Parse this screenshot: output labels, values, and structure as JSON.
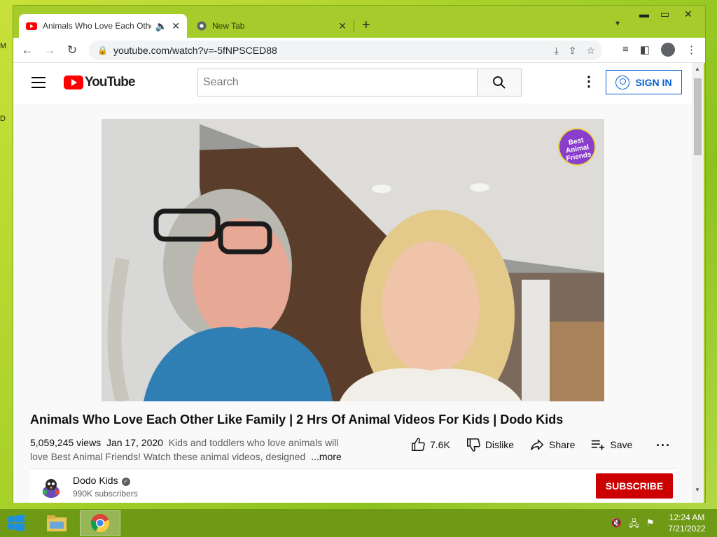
{
  "tabs": [
    {
      "label": "Animals Who Love Each Other Like Family",
      "active": true,
      "audio": true
    },
    {
      "label": "New Tab",
      "active": false
    }
  ],
  "new_tab_symbol": "+",
  "address": {
    "url": "youtube.com/watch?v=-5fNPSCED88"
  },
  "youtube": {
    "logo_text": "YouTube",
    "search_placeholder": "Search",
    "sign_in_label": "SIGN IN"
  },
  "video": {
    "overlay_logo": "Best Animal Friends",
    "title": "Animals Who Love Each Other Like Family | 2 Hrs Of Animal Videos For Kids | Dodo Kids",
    "views": "5,059,245 views",
    "date": "Jan 17, 2020",
    "description": "Kids and toddlers who love animals will love Best Animal Friends! Watch these animal videos, designed",
    "more_label": "...more",
    "likes": "7.6K",
    "dislike_label": "Dislike",
    "share_label": "Share",
    "save_label": "Save"
  },
  "channel": {
    "name": "Dodo Kids",
    "subscribers": "990K subscribers",
    "subscribe_label": "SUBSCRIBE"
  },
  "taskbar": {
    "time": "12:24 AM",
    "date": "7/21/2022"
  },
  "colors": {
    "youtube_red": "#ff0000",
    "subscribe_red": "#cc0000",
    "link_blue": "#065fd4",
    "desktop_green": "#a8d12a"
  }
}
